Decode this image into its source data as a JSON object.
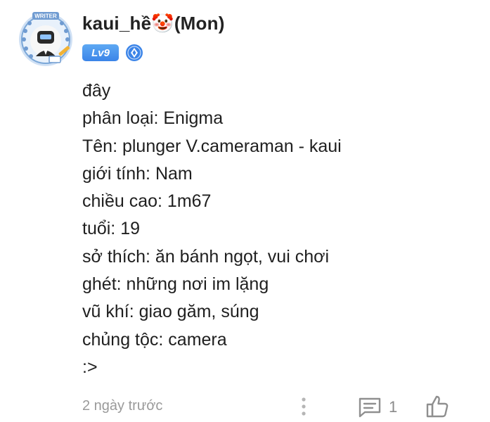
{
  "comment": {
    "author": {
      "name": "kaui_hề",
      "name_emoji": "🤡",
      "name_suffix": "(Mon)",
      "level": "Lv9",
      "avatar_badge_text": "WRITER",
      "avatar_icon": "writer-frame-avatar",
      "verified_icon": "blue-shield-verified-icon"
    },
    "lines": [
      "đây",
      "phân loại: Enigma",
      "Tên: plunger V.cameraman - kaui",
      "giới tính: Nam",
      "chiều cao: 1m67",
      "tuổi: 19",
      "sở thích: ăn bánh ngọt, vui chơi",
      "ghét: những nơi im lặng",
      "vũ khí: giao găm, súng",
      "chủng tộc: camera",
      ":>"
    ],
    "timestamp": "2 ngày trước",
    "reply_count": "1",
    "icons": {
      "more": "more-vertical-icon",
      "reply": "comment-icon",
      "like": "thumbs-up-icon"
    },
    "colors": {
      "level_badge": "#4a94ee",
      "verified": "#3b84e8",
      "meta_text": "#9a9a9a"
    }
  }
}
